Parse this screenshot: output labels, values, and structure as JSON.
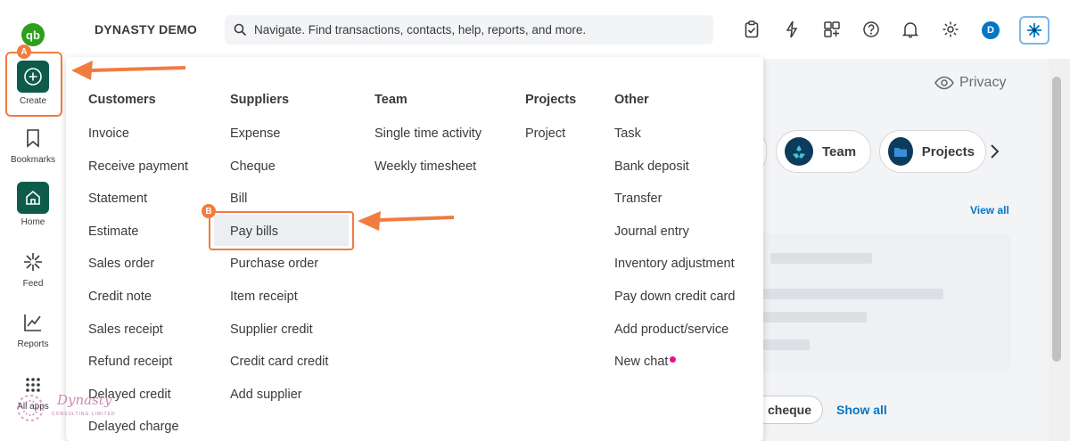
{
  "company_name": "DYNASTY DEMO",
  "search": {
    "text": "Navigate. Find transactions, contacts, help, reports, and more."
  },
  "avatar_initial": "D",
  "rail": {
    "create": "Create",
    "bookmarks": "Bookmarks",
    "home": "Home",
    "feed": "Feed",
    "reports": "Reports",
    "all_apps": "All apps"
  },
  "annotations": {
    "a": "A",
    "b": "B"
  },
  "menu": {
    "customers": {
      "title": "Customers",
      "items": [
        "Invoice",
        "Receive payment",
        "Statement",
        "Estimate",
        "Sales order",
        "Credit note",
        "Sales receipt",
        "Refund receipt",
        "Delayed credit",
        "Delayed charge"
      ]
    },
    "suppliers": {
      "title": "Suppliers",
      "items": [
        "Expense",
        "Cheque",
        "Bill",
        "Pay bills",
        "Purchase order",
        "Item receipt",
        "Supplier credit",
        "Credit card credit",
        "Add supplier"
      ]
    },
    "team": {
      "title": "Team",
      "items": [
        "Single time activity",
        "Weekly timesheet"
      ]
    },
    "projects": {
      "title": "Projects",
      "items": [
        "Project"
      ]
    },
    "other": {
      "title": "Other",
      "items": [
        "Task",
        "Bank deposit",
        "Transfer",
        "Journal entry",
        "Inventory adjustment",
        "Pay down credit card",
        "Add product/service",
        "New chat"
      ]
    }
  },
  "background": {
    "privacy": "Privacy",
    "pill_team": "Team",
    "pill_projects": "Projects",
    "view_all": "View all",
    "cheque_button": "cheque",
    "show_all": "Show all"
  },
  "watermark": {
    "name": "Dynasty",
    "sub": "CONSULTING LIMITED"
  },
  "colors": {
    "annotation": "#f07c3f",
    "brand_green": "#0d5c4b",
    "link_blue": "#0077c5",
    "new_dot": "#e8118c"
  }
}
